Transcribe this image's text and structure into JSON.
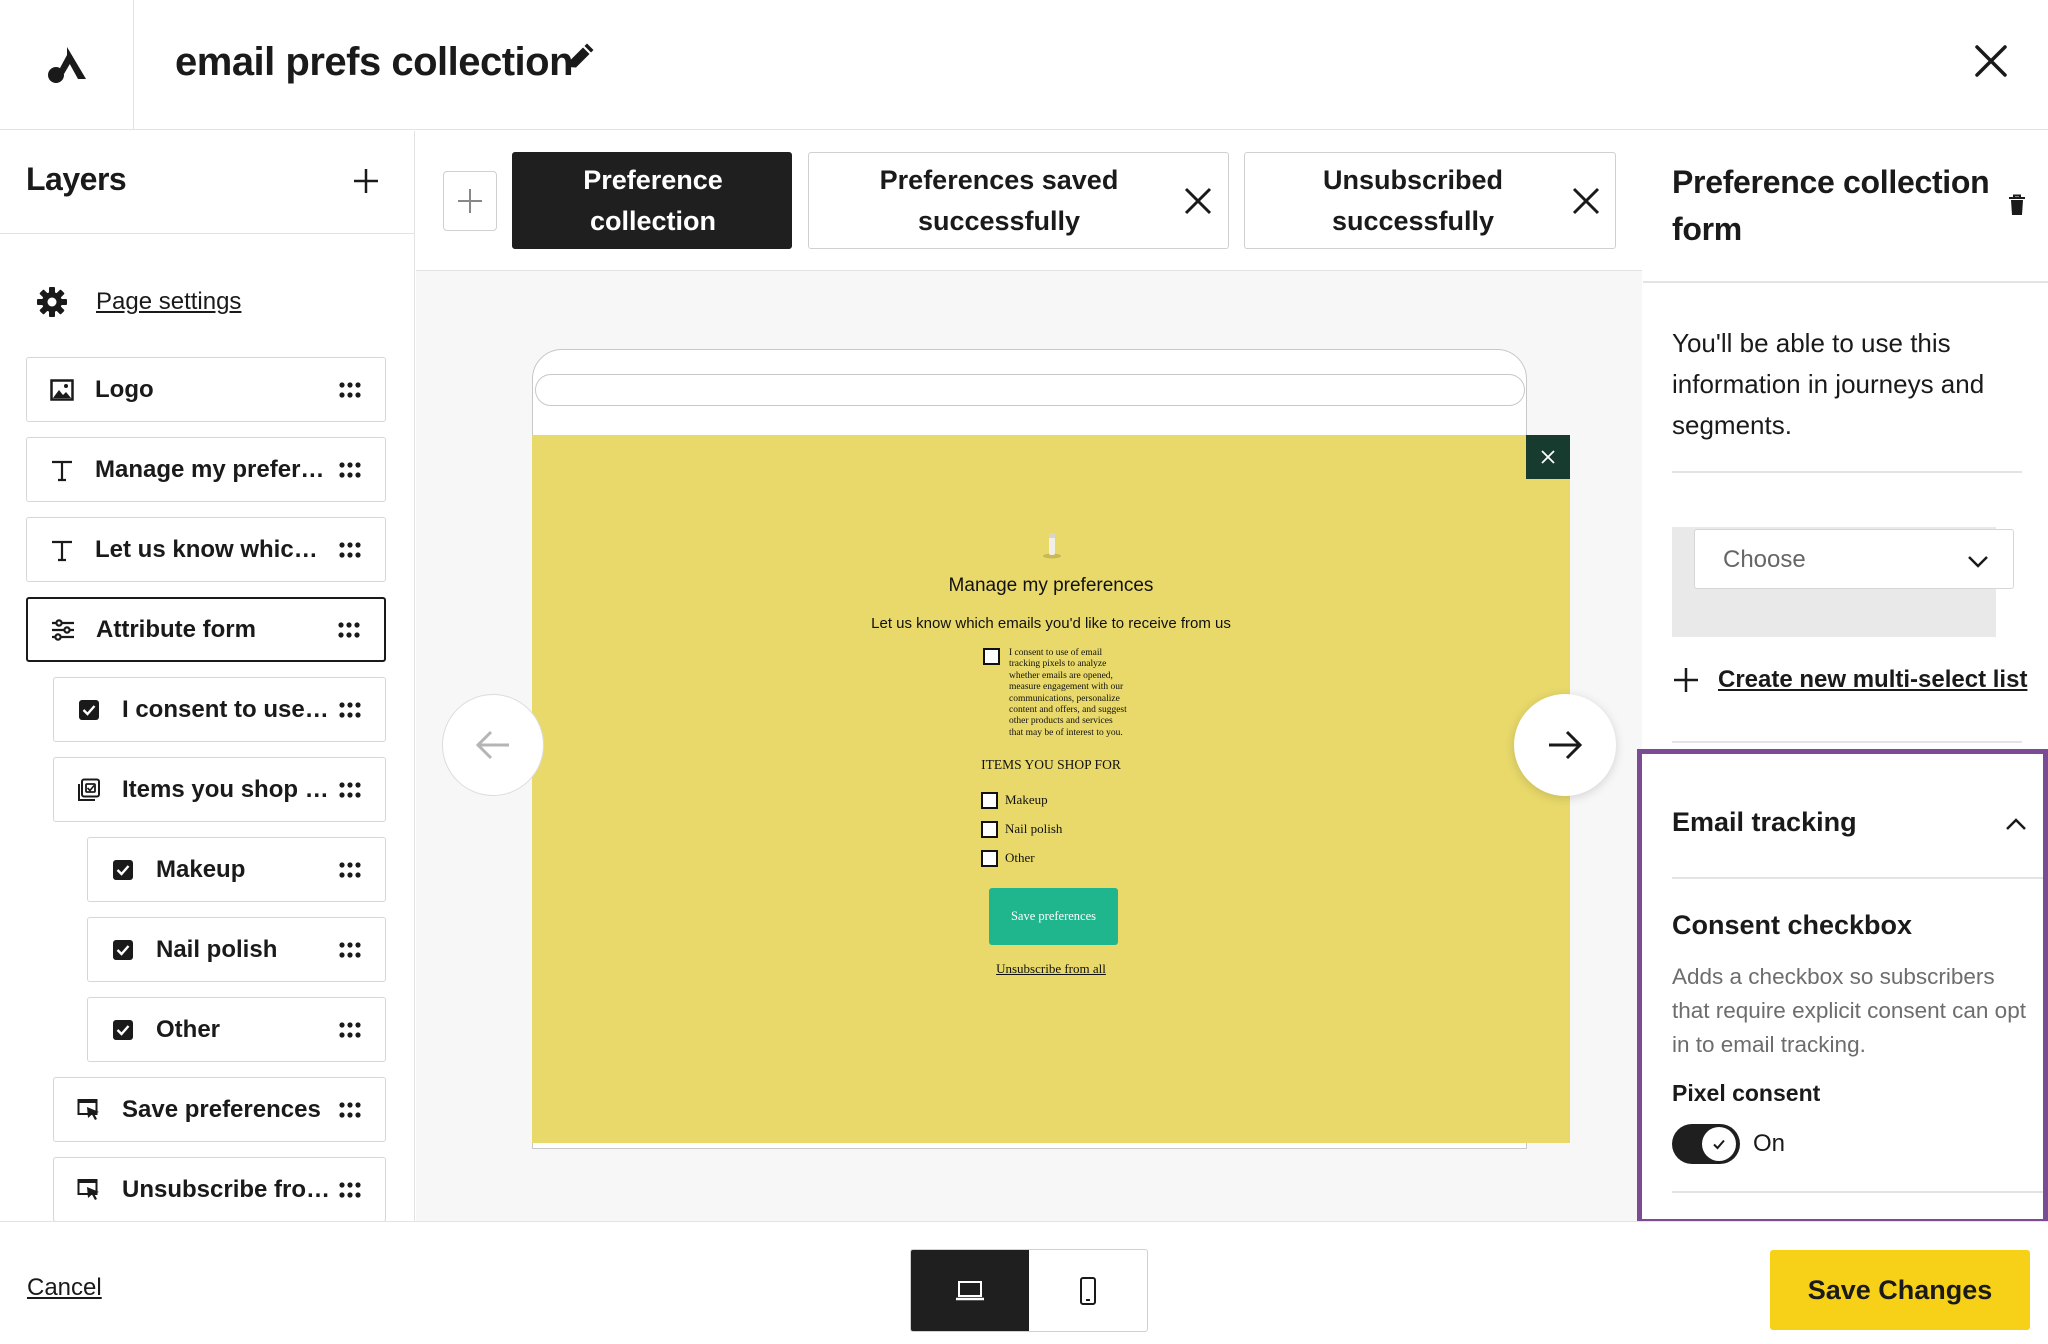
{
  "header": {
    "title": "email prefs collection",
    "icons": {
      "logo": "brand-logo-icon",
      "edit": "pencil-icon",
      "close": "close-icon"
    }
  },
  "layers_panel": {
    "title": "Layers",
    "page_settings_label": "Page settings",
    "items": [
      {
        "label": "Logo",
        "icon": "image-icon",
        "selected": false
      },
      {
        "label": "Manage my preferen...",
        "icon": "text-icon",
        "selected": false
      },
      {
        "label": "Let us know which e...",
        "icon": "text-icon",
        "selected": false
      },
      {
        "label": "Attribute form",
        "icon": "sliders-icon",
        "selected": true
      },
      {
        "label": "I consent to use of...",
        "icon": "checkbox-icon",
        "selected": false
      },
      {
        "label": "Items you shop for",
        "icon": "multi-select-icon",
        "selected": false
      },
      {
        "label": "Makeup",
        "icon": "checkbox-icon",
        "selected": false
      },
      {
        "label": "Nail polish",
        "icon": "checkbox-icon",
        "selected": false
      },
      {
        "label": "Other",
        "icon": "checkbox-icon",
        "selected": false
      },
      {
        "label": "Save preferences",
        "icon": "button-icon",
        "selected": false
      },
      {
        "label": "Unsubscribe from ...",
        "icon": "button-icon",
        "selected": false
      }
    ]
  },
  "tabs": [
    {
      "label_line1": "Preference",
      "label_line2": "collection",
      "active": true,
      "closable": false
    },
    {
      "label_line1": "Preferences saved",
      "label_line2": "successfully",
      "active": false,
      "closable": true
    },
    {
      "label_line1": "Unsubscribed",
      "label_line2": "successfully",
      "active": false,
      "closable": true
    }
  ],
  "preview": {
    "background": "#e8d96a",
    "title": "Manage my preferences",
    "subtitle": "Let us know which emails you'd like to receive from us",
    "consent_text": "I consent to use of email tracking pixels to analyze whether emails are opened, measure engagement with our communications, personalize content and offers, and suggest other products and services that may be of interest to you.",
    "items_heading": "ITEMS YOU SHOP FOR",
    "options": [
      "Makeup",
      "Nail polish",
      "Other"
    ],
    "save_button": "Save preferences",
    "unsubscribe_link": "Unsubscribe from all"
  },
  "properties_panel": {
    "title": "Preference collection form",
    "description": "You'll be able to use this information in journeys and segments.",
    "select_placeholder": "Choose",
    "create_link": "Create new multi-select list",
    "section_title": "Email tracking",
    "consent_title": "Consent checkbox",
    "consent_description": "Adds a checkbox so subscribers that require explicit consent can opt in to email tracking.",
    "pixel_label": "Pixel consent",
    "pixel_value": "On",
    "pixel_enabled": true,
    "highlight_color": "#7b4b94"
  },
  "footer": {
    "cancel_label": "Cancel",
    "save_label": "Save Changes",
    "save_color": "#f7d117",
    "device_modes": [
      "desktop-icon",
      "mobile-icon"
    ],
    "active_device": "desktop"
  }
}
